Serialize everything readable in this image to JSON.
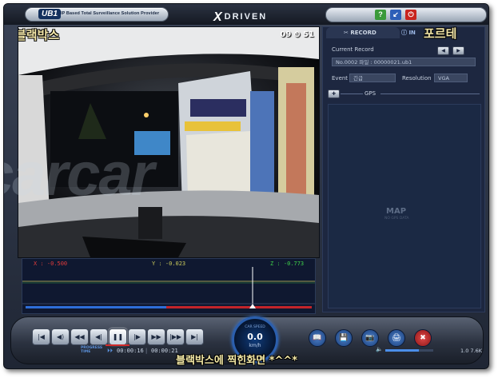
{
  "brand": {
    "logo": "UB1",
    "tagline": "IP Based Total Surveillance Solution Provider",
    "product_x": "X",
    "product_rest": "DRIVEN"
  },
  "window_buttons": {
    "help": "?",
    "minimize": "↙",
    "power": "⏻"
  },
  "video": {
    "overlay_label": "블랙박스",
    "time": "09 ⏲ 51"
  },
  "graph": {
    "x_label": "X : -0.500",
    "y_label": "Y : -0.023",
    "z_label": "Z : -0.773"
  },
  "panel": {
    "tabs": {
      "record": "RECORD",
      "info_prefix": "IN",
      "overlay": "포르테"
    },
    "current_record_label": "Current Record",
    "record_value": "No.0002  파일 : 00000021.ub1",
    "event_label": "Event",
    "event_value": "긴급",
    "resolution_label": "Resolution",
    "resolution_value": "VGA",
    "gps_label": "GPS",
    "map_label": "MAP",
    "map_sub": "NO GPS DATA"
  },
  "watermark": "carcar",
  "controls": {
    "buttons": [
      "|◀",
      "◀)",
      "◀◀",
      "◀|",
      "❚❚",
      "|▶",
      "▶▶",
      "|▶▶",
      "▶|"
    ],
    "progress_label": "PROGRESS",
    "time_label": "TIME",
    "current_time": "00:00:16",
    "total_time": "00:00:21",
    "speed_label": "CAR SPEED",
    "speed_value": "0.0",
    "speed_unit": "km/h",
    "round_buttons": [
      "📖",
      "💾",
      "📷",
      "🖨",
      "✖"
    ],
    "volume_level": 0.7,
    "file_size": "1.0 7.6K"
  },
  "caption": "블랙박스에 찍힌화면 *^^*",
  "colors": {
    "x_axis": "#e23b3b",
    "y_axis": "#c8c85a",
    "z_axis": "#3fd24a",
    "accent": "#2b5fae"
  }
}
